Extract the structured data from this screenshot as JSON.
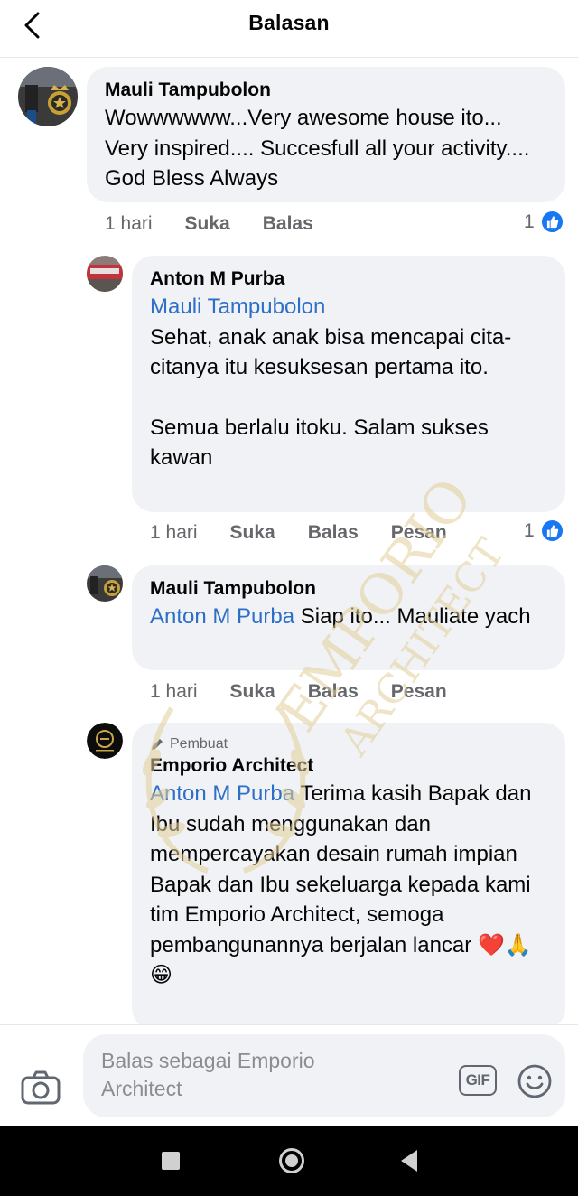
{
  "header": {
    "title": "Balasan",
    "back_icon": "chevron-left-icon"
  },
  "comments": [
    {
      "author": "Mauli Tampubolon",
      "text": "Wowwwwww...Very awesome house ito... Very inspired.... Succesfull all your activity.... God Bless Always",
      "time": "1 hari",
      "like_label": "Suka",
      "reply_label": "Balas",
      "reaction_count": "1"
    },
    {
      "author": "Anton M Purba",
      "mention": "Mauli Tampubolon",
      "text_line1": "Sehat, anak anak bisa mencapai cita-citanya itu kesuksesan pertama ito.",
      "text_line2": "Semua berlalu itoku. Salam sukses kawan",
      "time": "1 hari",
      "like_label": "Suka",
      "reply_label": "Balas",
      "message_label": "Pesan",
      "reaction_count": "1"
    },
    {
      "author": "Mauli Tampubolon",
      "mention": "Anton M Purba",
      "text": " Siap ito... Mauliate yach",
      "time": "1 hari",
      "like_label": "Suka",
      "reply_label": "Balas",
      "message_label": "Pesan"
    },
    {
      "badge": "Pembuat",
      "author": "Emporio Architect",
      "mention": "Anton M Purba",
      "text": " Terima kasih Bapak dan Ibu sudah menggunakan dan mempercayakan desain rumah impian Bapak dan Ibu sekeluarga kepada kami tim Emporio Architect, semoga pembangunannya berjalan lancar",
      "emojis": "❤️🙏😁"
    }
  ],
  "watermark": {
    "line1": "EMPORIO",
    "line2": "ARCHITECT"
  },
  "reply_bar": {
    "placeholder": "Balas sebagai Emporio Architect",
    "gif_label": "GIF"
  },
  "colors": {
    "mention": "#2d6ec7",
    "like_blue": "#1877f2",
    "bubble": "#f0f2f5",
    "watermark_gold": "#e3cf9a"
  }
}
